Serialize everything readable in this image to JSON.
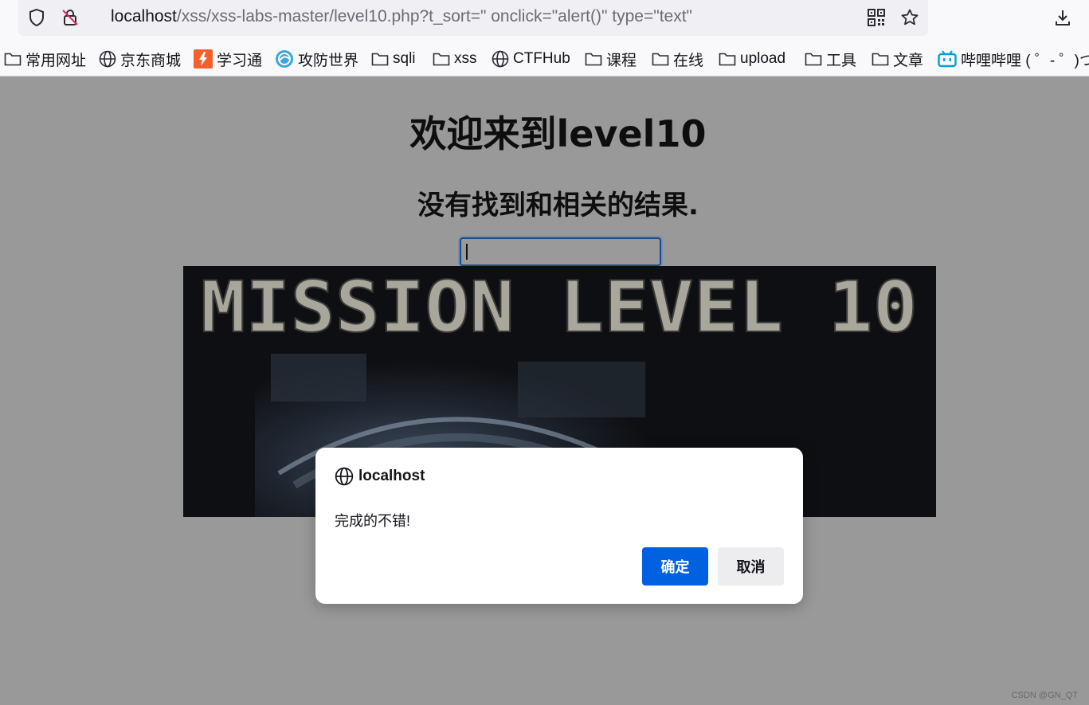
{
  "browser": {
    "url_host": "localhost",
    "url_path": "/xss/xss-labs-master/level10.php?t_sort=\" onclick=\"alert()\" type=\"text\"",
    "icons": [
      "shield-icon",
      "insecure-lock-icon",
      "qr-code-icon",
      "star-icon",
      "download-icon"
    ]
  },
  "bookmarks": [
    {
      "label": "常用网址",
      "icon": "folder-icon"
    },
    {
      "label": "京东商城",
      "icon": "globe-icon"
    },
    {
      "label": "学习通",
      "icon": "xuexitong-icon"
    },
    {
      "label": "攻防世界",
      "icon": "gongfang-icon"
    },
    {
      "label": "sqli",
      "icon": "folder-icon"
    },
    {
      "label": "xss",
      "icon": "folder-icon"
    },
    {
      "label": "CTFHub",
      "icon": "globe-icon"
    },
    {
      "label": "课程",
      "icon": "folder-icon"
    },
    {
      "label": "在线",
      "icon": "folder-icon"
    },
    {
      "label": "upload",
      "icon": "folder-icon"
    },
    {
      "label": "工具",
      "icon": "folder-icon"
    },
    {
      "label": "文章",
      "icon": "folder-icon"
    },
    {
      "label": "哔哩哔哩 ( ゜- ゜)つロ",
      "icon": "bilibili-icon"
    }
  ],
  "page": {
    "heading": "欢迎来到level10",
    "subheading": "没有找到和相关的结果.",
    "input_value": "",
    "banner_text": "MISSION LEVEL 10",
    "watermark": "CSDN @GN_QT"
  },
  "dialog": {
    "host": "localhost",
    "message": "完成的不错!",
    "ok_label": "确定",
    "cancel_label": "取消"
  },
  "colors": {
    "page_bg": "#999999",
    "ok_button": "#0061e0",
    "input_border": "#1a4a8c"
  }
}
